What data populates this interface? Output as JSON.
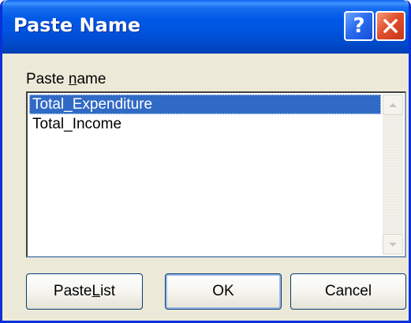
{
  "window": {
    "title": "Paste Name",
    "help_glyph": "?",
    "help_icon": "question-mark-icon",
    "close_icon": "close-x-icon",
    "title_color": "#0058e6",
    "close_color": "#e0502c"
  },
  "field": {
    "label_before": "Paste ",
    "label_mnemonic": "n",
    "label_after": "ame"
  },
  "list": {
    "items": [
      "Total_Expenditure",
      "Total_Income"
    ],
    "selected_index": 0,
    "selection_color": "#316ac5"
  },
  "buttons": {
    "paste_list": {
      "before": "Paste ",
      "mnemonic": "L",
      "after": "ist"
    },
    "ok": {
      "label": "OK"
    },
    "cancel": {
      "label": "Cancel"
    }
  }
}
